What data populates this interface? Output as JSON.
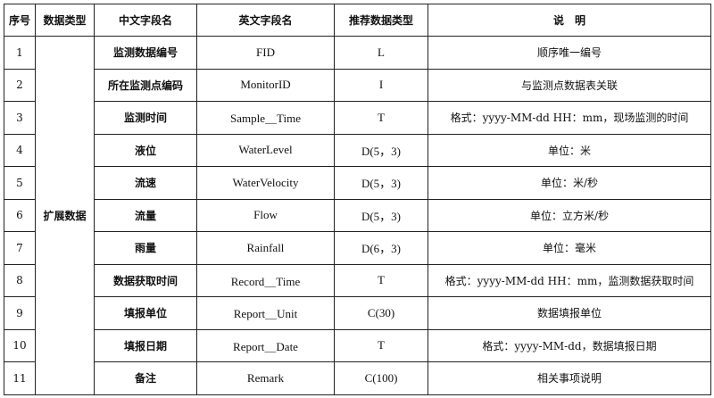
{
  "headers": [
    "序号",
    "数据类型",
    "中文字段名",
    "英文字段名",
    "推荐数据类型",
    "说　明"
  ],
  "category": "扩展数据",
  "rows": [
    {
      "no": "1",
      "cn": "监测数据编号",
      "en": "FID",
      "type": "L",
      "desc": "顺序唯一编号"
    },
    {
      "no": "2",
      "cn": "所在监测点编码",
      "en": "MonitorID",
      "type": "I",
      "desc": "与监测点数据表关联"
    },
    {
      "no": "3",
      "cn": "监测时间",
      "en": "Sample＿Time",
      "type": "T",
      "desc": "格式：yyyy-MM-dd HH：mm，现场监测的时间"
    },
    {
      "no": "4",
      "cn": "液位",
      "en": "WaterLevel",
      "type": "D(5，3)",
      "desc": "单位：米"
    },
    {
      "no": "5",
      "cn": "流速",
      "en": "WaterVelocity",
      "type": "D(5，3)",
      "desc": "单位：米/秒"
    },
    {
      "no": "6",
      "cn": "流量",
      "en": "Flow",
      "type": "D(5，3)",
      "desc": "单位：立方米/秒"
    },
    {
      "no": "7",
      "cn": "雨量",
      "en": "Rainfall",
      "type": "D(6，3)",
      "desc": "单位：毫米"
    },
    {
      "no": "8",
      "cn": "数据获取时间",
      "en": "Record＿Time",
      "type": "T",
      "desc": "格式：yyyy-MM-dd HH：mm，监测数据获取时间"
    },
    {
      "no": "9",
      "cn": "填报单位",
      "en": "Report＿Unit",
      "type": "C(30)",
      "desc": "数据填报单位"
    },
    {
      "no": "10",
      "cn": "填报日期",
      "en": "Report＿Date",
      "type": "T",
      "desc": "格式：yyyy-MM-dd，数据填报日期"
    },
    {
      "no": "11",
      "cn": "备注",
      "en": "Remark",
      "type": "C(100)",
      "desc": "相关事项说明"
    }
  ]
}
